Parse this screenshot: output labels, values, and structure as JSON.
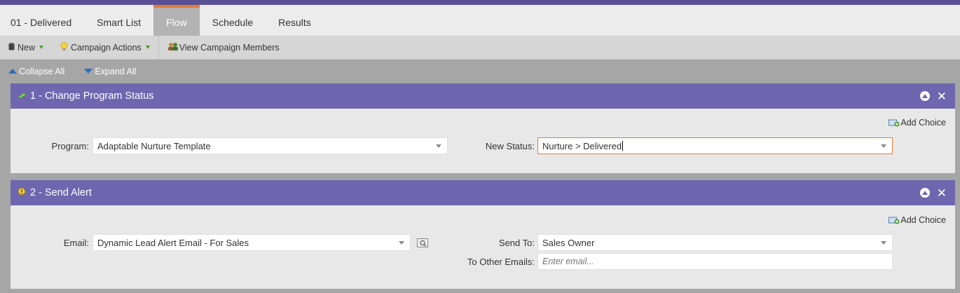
{
  "tabs": [
    {
      "label": "01 - Delivered"
    },
    {
      "label": "Smart List"
    },
    {
      "label": "Flow"
    },
    {
      "label": "Schedule"
    },
    {
      "label": "Results"
    }
  ],
  "active_tab": "Flow",
  "toolbar": {
    "new_label": "New",
    "campaign_actions_label": "Campaign Actions",
    "view_members_label": "View Campaign Members"
  },
  "collapse": {
    "collapse_all": "Collapse All",
    "expand_all": "Expand All"
  },
  "steps": [
    {
      "title": "1 - Change Program Status",
      "add_choice": "Add Choice",
      "program_label": "Program:",
      "program_value": "Adaptable Nurture Template",
      "status_label": "New Status:",
      "status_value": "Nurture > Delivered"
    },
    {
      "title": "2 - Send Alert",
      "add_choice": "Add Choice",
      "email_label": "Email:",
      "email_value": "Dynamic Lead Alert Email - For Sales",
      "send_to_label": "Send To:",
      "send_to_value": "Sales Owner",
      "other_emails_label": "To Other Emails:",
      "other_emails_placeholder": "Enter email..."
    }
  ],
  "colors": {
    "header_purple": "#6f66b0",
    "topbar_purple": "#5a5096",
    "active_tab_accent": "#e07b39"
  }
}
